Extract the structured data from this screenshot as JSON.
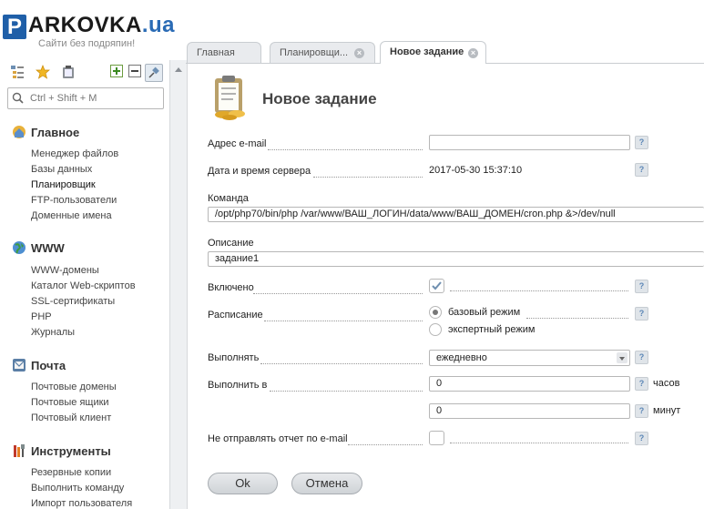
{
  "brand": {
    "logo_letter": "P",
    "logo_rest": "ARKOVKA",
    "logo_domain": ".ua",
    "slogan": "Сайти без подряпин!"
  },
  "sidebar": {
    "search_placeholder": "Ctrl + Shift + M",
    "sections": [
      {
        "title": "Главное",
        "items": [
          "Менеджер файлов",
          "Базы данных",
          "Планировщик",
          "FTP-пользователи",
          "Доменные имена"
        ]
      },
      {
        "title": "WWW",
        "items": [
          "WWW-домены",
          "Каталог Web-скриптов",
          "SSL-сертификаты",
          "PHP",
          "Журналы"
        ]
      },
      {
        "title": "Почта",
        "items": [
          "Почтовые домены",
          "Почтовые ящики",
          "Почтовый клиент"
        ]
      },
      {
        "title": "Инструменты",
        "items": [
          "Резервные копии",
          "Выполнить команду",
          "Импорт пользователя"
        ]
      }
    ]
  },
  "tabs": [
    {
      "label": "Главная"
    },
    {
      "label": "Планировщи..."
    },
    {
      "label": "Новое задание"
    }
  ],
  "form": {
    "title": "Новое задание",
    "email_label": "Адрес e-mail",
    "email_value": "",
    "server_time_label": "Дата и время сервера",
    "server_time_value": "2017-05-30 15:37:10",
    "command_label": "Команда",
    "command_value": "/opt/php70/bin/php /var/www/ВАШ_ЛОГИН/data/www/ВАШ_ДОМЕН/cron.php &>/dev/null",
    "description_label": "Описание",
    "description_value": "задание1",
    "enabled_label": "Включено",
    "enabled_checked": true,
    "schedule_label": "Расписание",
    "schedule_basic": "базовый режим",
    "schedule_expert": "экспертный режим",
    "run_label": "Выполнять",
    "run_value": "ежедневно",
    "run_at_label": "Выполнить в",
    "hours_value": "0",
    "hours_unit": "часов",
    "minutes_value": "0",
    "minutes_unit": "минут",
    "no_report_label": "Не отправлять отчет по e-mail",
    "no_report_checked": false,
    "help_symbol": "?",
    "ok_label": "Ok",
    "cancel_label": "Отмена"
  },
  "colors": {
    "brand_blue": "#1f5fa8",
    "help_text": "#5b86b6"
  }
}
